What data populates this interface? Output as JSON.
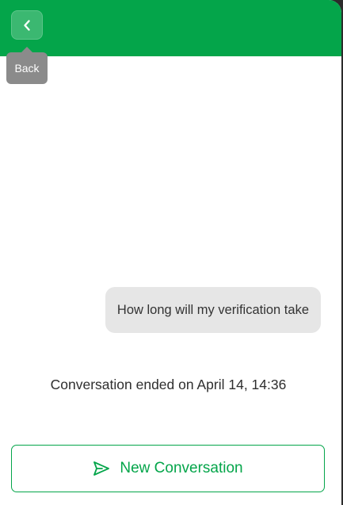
{
  "header": {
    "back_icon": "chevron-left-icon",
    "back_tooltip": "Back"
  },
  "chat": {
    "user_message": "How long will my verification take",
    "status_text": "Conversation ended on April 14, 14:36"
  },
  "footer": {
    "new_conversation_label": "New Conversation",
    "new_conversation_icon": "send-icon"
  },
  "colors": {
    "brand_green": "#04a54a",
    "bubble_bg": "#e6e6e6",
    "tooltip_bg": "#8b8b8b"
  }
}
